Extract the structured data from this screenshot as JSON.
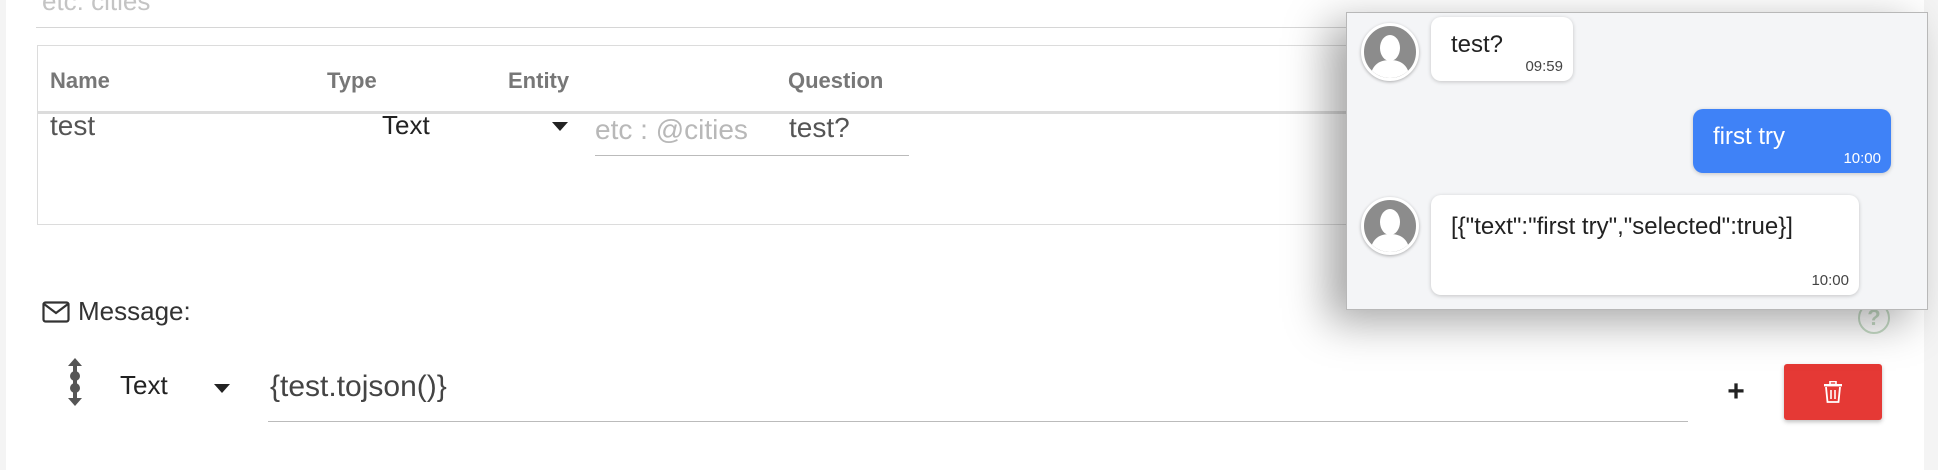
{
  "top_field": {
    "placeholder": "etc: cities"
  },
  "params_table": {
    "headers": {
      "name": "Name",
      "type": "Type",
      "entity": "Entity",
      "question": "Question"
    },
    "row": {
      "name": "test",
      "type": "Text",
      "entity_placeholder": "etc : @cities",
      "question": "test?"
    }
  },
  "message_section": {
    "label": "Message:",
    "type": "Text",
    "value": "{test.tojson()}",
    "add_label": "+",
    "help_label": "?"
  },
  "chat": {
    "messages": [
      {
        "from": "bot",
        "text": "test?",
        "time": "09:59"
      },
      {
        "from": "user",
        "text": "first try",
        "time": "10:00"
      },
      {
        "from": "bot",
        "text": "[{\"text\":\"first try\",\"selected\":true}]",
        "time": "10:00"
      }
    ]
  },
  "colors": {
    "delete": "#e53935",
    "user_bubble": "#3f82f7",
    "help": "#c6dcc6"
  },
  "icons": {
    "message": "envelope-icon",
    "drag": "drag-handle-icon",
    "delete": "trash-icon",
    "avatar": "user-silhouette-icon",
    "help": "question-circle-icon"
  }
}
